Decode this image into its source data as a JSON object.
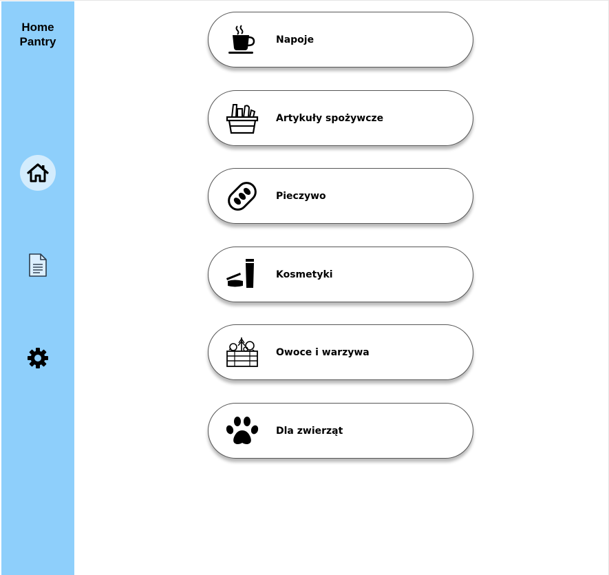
{
  "app": {
    "brand_line1": "Home",
    "brand_line2": "Pantry"
  },
  "sidebar": {
    "items": [
      {
        "icon": "home-icon",
        "active": true
      },
      {
        "icon": "document-icon",
        "active": false
      },
      {
        "icon": "gear-icon",
        "active": false
      }
    ],
    "background": "#8ecffb",
    "active_background": "#d3ecfd"
  },
  "categories": [
    {
      "label": "Napoje",
      "icon": "coffee-cup-icon"
    },
    {
      "label": "Artykuły spożywcze",
      "icon": "grocery-basket-icon"
    },
    {
      "label": "Pieczywo",
      "icon": "bread-icon"
    },
    {
      "label": "Kosmetyki",
      "icon": "cosmetics-icon"
    },
    {
      "label": "Owoce i warzywa",
      "icon": "vegetable-crate-icon"
    },
    {
      "label": "Dla zwierząt",
      "icon": "paw-icon"
    }
  ]
}
